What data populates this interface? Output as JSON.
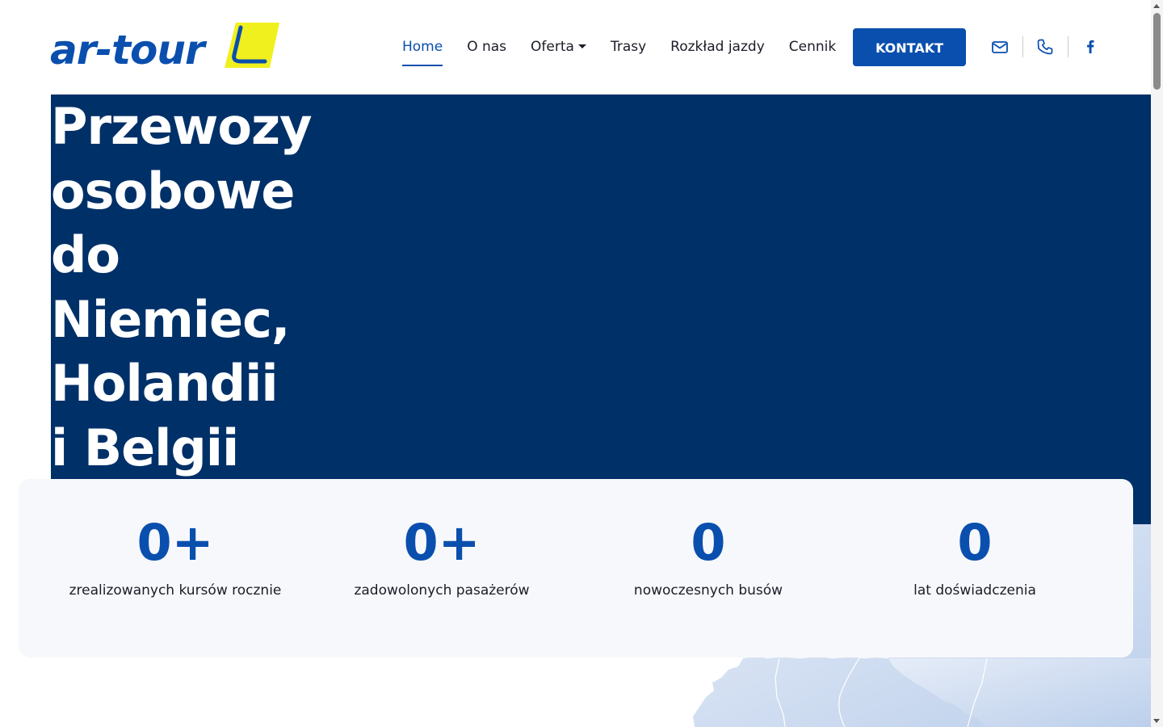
{
  "brand": {
    "name": "ar-tour",
    "primary_color": "#0a4fae",
    "accent_color": "#f0f01e",
    "hero_bg_color": "#003068"
  },
  "nav": {
    "items": [
      {
        "label": "Home",
        "active": true
      },
      {
        "label": "O nas"
      },
      {
        "label": "Oferta",
        "has_dropdown": true
      },
      {
        "label": "Trasy"
      },
      {
        "label": "Rozkład jazdy"
      },
      {
        "label": "Cennik"
      }
    ],
    "cta_label": "KONTAKT",
    "icons": [
      "mail-icon",
      "phone-icon",
      "facebook-icon"
    ]
  },
  "hero": {
    "title_lines": [
      "Przewozy",
      "osobowe",
      "do",
      "Niemiec,",
      "Holandii",
      "i Belgii"
    ]
  },
  "stats": [
    {
      "value": "0+",
      "label": "zrealizowanych kursów rocznie"
    },
    {
      "value": "0+",
      "label": "zadowolonych pasażerów"
    },
    {
      "value": "0",
      "label": "nowoczesnych busów"
    },
    {
      "value": "0",
      "label": "lat doświadczenia"
    }
  ]
}
